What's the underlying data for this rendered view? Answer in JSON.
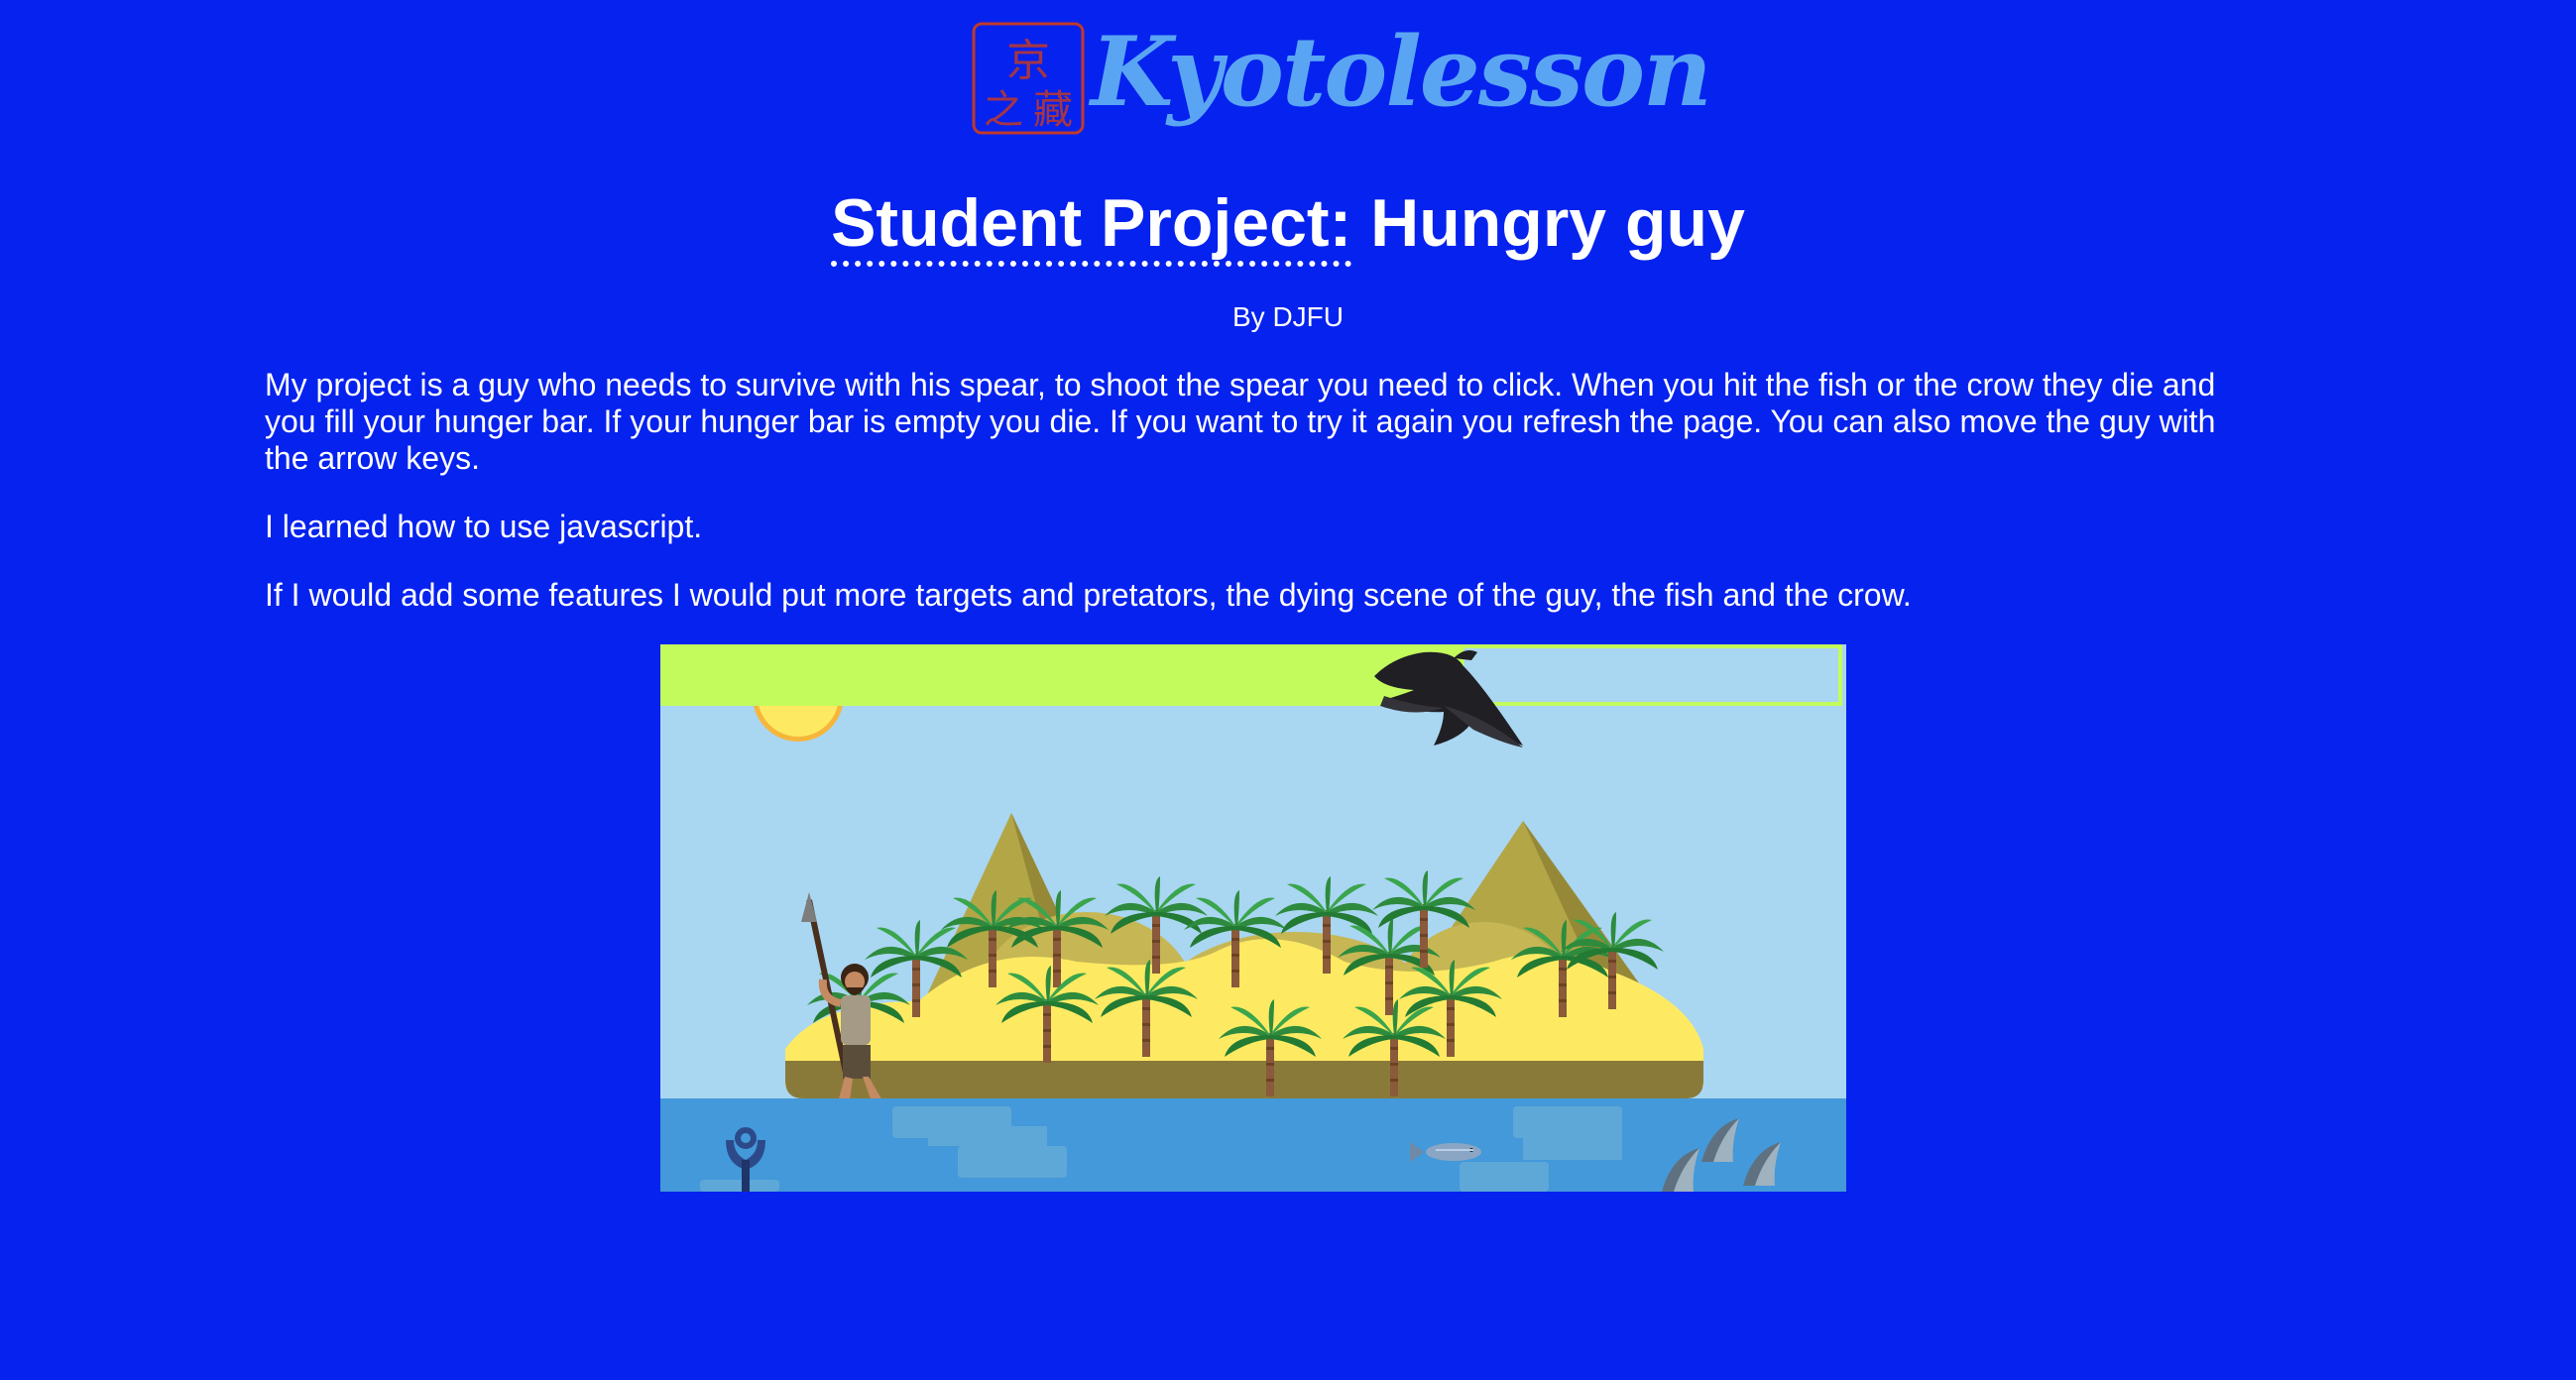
{
  "brand": {
    "name": "Kyotolesson",
    "seal_text": "京之藏",
    "brand_color": "#5aa5f3",
    "seal_color": "#c0392b"
  },
  "article": {
    "title_abbr": "Student Project:",
    "title_rest": " Hungry guy",
    "byline": "By DJFU",
    "paragraphs": [
      "My project is a guy who needs to survive with his spear, to shoot the spear you need to click. When you hit the fish or the crow they die and you fill your hunger bar. If your hunger bar is empty you die. If you want to try it again you refresh the page. You can also move the guy with the arrow keys.",
      "I learned how to use javascript.",
      "If I would add some features I would put more targets and pretators, the dying scene of the guy, the fish and the crow."
    ]
  },
  "game": {
    "hunger_level": 0.68,
    "colors": {
      "page_background": "#0622ee",
      "sky": "#a9d6f1",
      "hunger_bar": "#c3fb5c",
      "sea": "#4399d9",
      "sand": "#feea62",
      "mountain": "#b3a647"
    },
    "icons": [
      "sun-icon",
      "crow-icon",
      "caveman-icon",
      "fish-icon",
      "shark-fin-icon",
      "palm-tree-icon",
      "anchor-icon"
    ]
  }
}
